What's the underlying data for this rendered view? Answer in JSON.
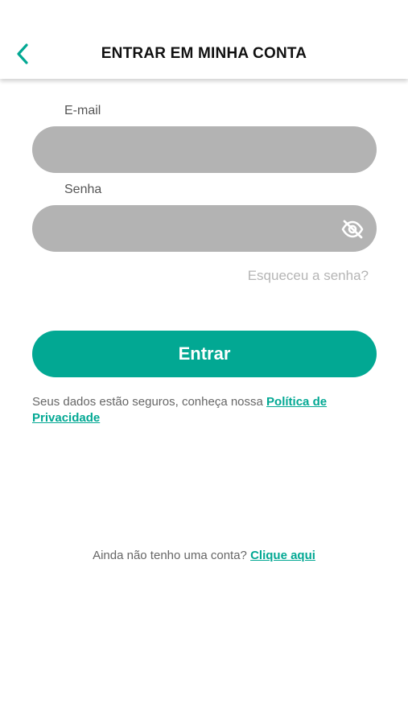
{
  "header": {
    "title": "ENTRAR EM MINHA CONTA",
    "back_icon": "chevron-left-icon"
  },
  "form": {
    "email_label": "E-mail",
    "email_value": "",
    "password_label": "Senha",
    "password_value": "",
    "password_toggle_icon": "eye-off-icon",
    "forgot_password": "Esqueceu a senha?",
    "submit_label": "Entrar"
  },
  "privacy": {
    "text": "Seus dados estão seguros, conheça nossa",
    "link": "Política de Privacidade"
  },
  "signup": {
    "text": "Ainda não tenho uma conta?",
    "link": "Clique aqui"
  },
  "colors": {
    "accent": "#02a893",
    "input_background": "#b3b3b3",
    "muted_text": "#b5b5b5"
  }
}
